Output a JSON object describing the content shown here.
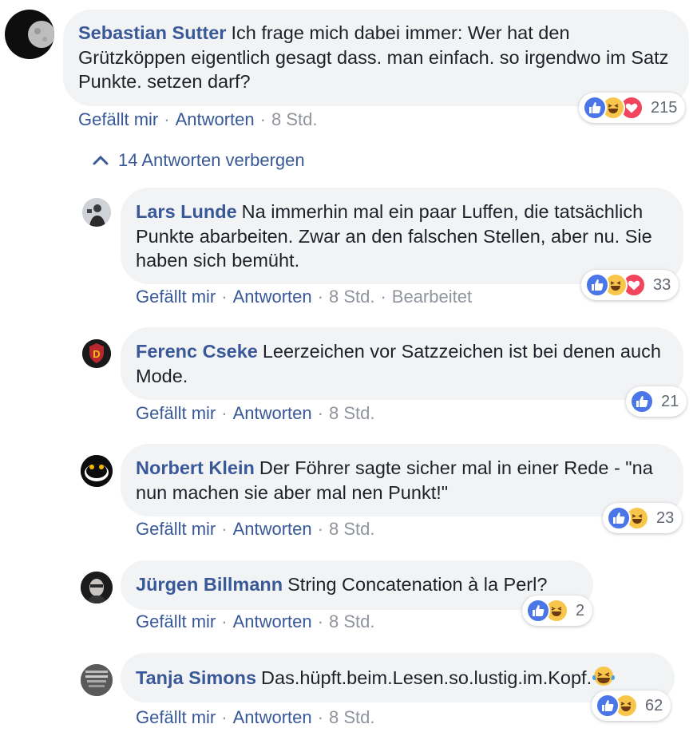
{
  "colors": {
    "link": "#385898",
    "meta_grey": "#90949c",
    "bubble": "#f2f3f5",
    "like": "#4a76e8",
    "haha": "#f7c64a",
    "love": "#f0455c"
  },
  "comment": {
    "author": "Sebastian Sutter",
    "text": "Ich frage mich dabei immer: Wer hat den Grützköppen eigentlich gesagt dass. man einfach. so irgendwo im Satz Punkte. setzen darf?",
    "like_label": "Gefällt mir",
    "reply_label": "Antworten",
    "time": "8 Std.",
    "reactions": [
      "like-icon",
      "haha-icon",
      "love-icon"
    ],
    "reaction_count": "215"
  },
  "replies_toggle": {
    "label": "14 Antworten verbergen",
    "icon": "chevron-up-icon"
  },
  "replies": [
    {
      "author": "Lars Lunde",
      "text": "Na immerhin mal ein paar Luffen, die tatsächlich Punkte abarbeiten. Zwar an den falschen Stellen, aber nu. Sie haben sich bemüht.",
      "like_label": "Gefällt mir",
      "reply_label": "Antworten",
      "time": "8 Std.",
      "edited": "Bearbeitet",
      "reactions": [
        "like-icon",
        "haha-icon",
        "love-icon"
      ],
      "reaction_count": "33"
    },
    {
      "author": "Ferenc Cseke",
      "text": "Leerzeichen vor Satzzeichen ist bei denen auch Mode.",
      "like_label": "Gefällt mir",
      "reply_label": "Antworten",
      "time": "8 Std.",
      "reactions": [
        "like-icon"
      ],
      "reaction_count": "21"
    },
    {
      "author": "Norbert Klein",
      "text": "Der Föhrer sagte sicher mal in einer Rede - \"na nun machen sie aber mal nen Punkt!\"",
      "like_label": "Gefällt mir",
      "reply_label": "Antworten",
      "time": "8 Std.",
      "reactions": [
        "like-icon",
        "haha-icon"
      ],
      "reaction_count": "23"
    },
    {
      "author": "Jürgen Billmann",
      "text": "String Concatenation à la Perl?",
      "like_label": "Gefällt mir",
      "reply_label": "Antworten",
      "time": "8 Std.",
      "reactions": [
        "like-icon",
        "haha-icon"
      ],
      "reaction_count": "2"
    },
    {
      "author": "Tanja Simons",
      "text": "Das.hüpft.beim.Lesen.so.lustig.im.Kopf.",
      "inline_emoji": "tears-of-joy-emoji",
      "like_label": "Gefällt mir",
      "reply_label": "Antworten",
      "time": "8 Std.",
      "reactions": [
        "like-icon",
        "haha-icon"
      ],
      "reaction_count": "62"
    }
  ]
}
